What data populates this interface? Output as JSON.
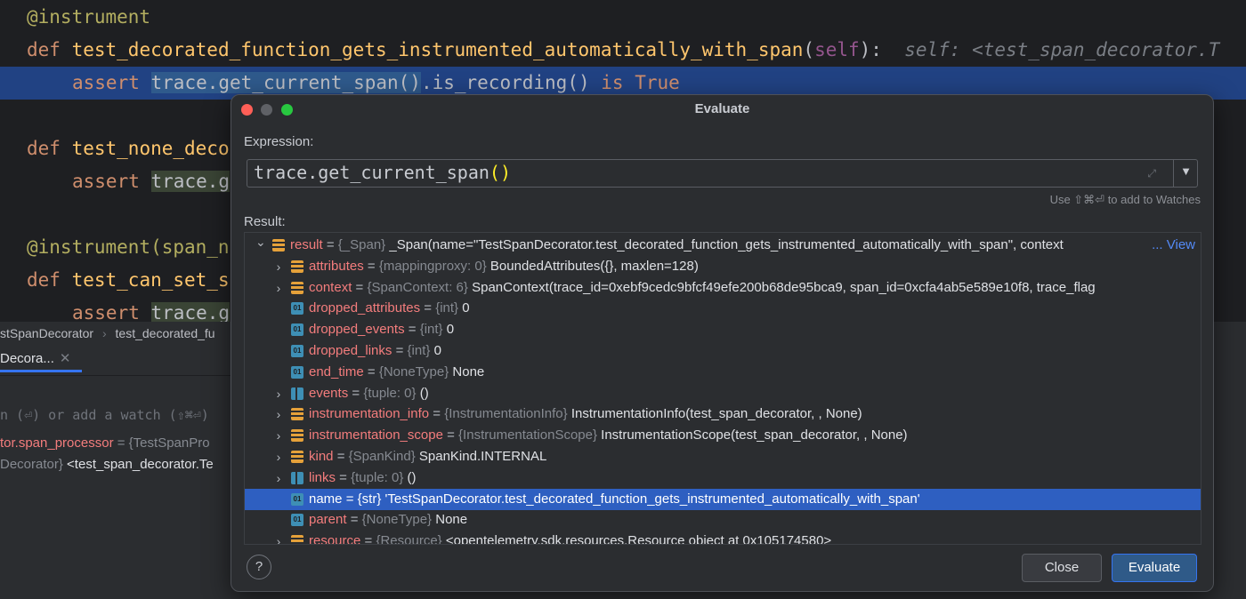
{
  "editor": {
    "line1": {
      "decorator": "@instrument"
    },
    "line2": {
      "kw": "def",
      "fn": "test_decorated_function_gets_instrumented_automatically_with_span",
      "open": "(",
      "self": "self",
      "close": "):",
      "hint": "self: <test_span_decorator.T"
    },
    "line3": {
      "kw": "assert",
      "call": "trace.get_current_span()",
      "rest": ".is_recording()",
      "is": "is",
      "val": "True"
    },
    "line5": {
      "kw": "def",
      "fn": "test_none_deco"
    },
    "line6": {
      "kw": "assert",
      "text": "trace.g"
    },
    "line8": {
      "decorator": "@instrument",
      "rest": "(span_n"
    },
    "line9": {
      "kw": "def",
      "fn": "test_can_set_s"
    },
    "line10": {
      "kw": "assert",
      "text": "trace.g"
    }
  },
  "lower": {
    "breadcrumb": [
      "stSpanDecorator",
      "test_decorated_fu"
    ],
    "breadcrumb_sep": "›",
    "tab_label": "Decora...",
    "tab_close": "✕",
    "watch_hint": "n (⏎) or add a watch (⇧⌘⏎)",
    "var1_name": "tor.span_processor",
    "var1_rest": "= {TestSpanPro",
    "var2_type": "Decorator}",
    "var2_val": "<test_span_decorator.Te"
  },
  "dialog": {
    "title": "Evaluate",
    "expression_label": "Expression:",
    "expression_main": "trace.get_current_span",
    "expression_parens": "()",
    "watch_hint": "Use ⇧⌘⏎ to add to Watches",
    "result_label": "Result:",
    "view_link": "... View",
    "close_button": "Close",
    "evaluate_button": "Evaluate",
    "help": "?",
    "colors": {
      "close": "#ff5f57",
      "minimize": "#5f6166",
      "zoom": "#28c840",
      "selection": "#2e5fc1"
    },
    "tree": [
      {
        "name": "result",
        "type": "{_Span}",
        "value": "_Span(name=\"TestSpanDecorator.test_decorated_function_gets_instrumented_automatically_with_span\", context",
        "icon": "obj",
        "arrow": "down",
        "indent": 0
      },
      {
        "name": "attributes",
        "type": "{mappingproxy: 0}",
        "value": "BoundedAttributes({}, maxlen=128)",
        "icon": "obj",
        "arrow": "right",
        "indent": 1
      },
      {
        "name": "context",
        "type": "{SpanContext: 6}",
        "value": "SpanContext(trace_id=0xebf9cedc9bfcf49efe200b68de95bca9, span_id=0xcfa4ab5e589e10f8, trace_flag",
        "icon": "obj",
        "arrow": "right",
        "indent": 1
      },
      {
        "name": "dropped_attributes",
        "type": "{int}",
        "value": "0",
        "icon": "prim",
        "arrow": "",
        "indent": 1
      },
      {
        "name": "dropped_events",
        "type": "{int}",
        "value": "0",
        "icon": "prim",
        "arrow": "",
        "indent": 1
      },
      {
        "name": "dropped_links",
        "type": "{int}",
        "value": "0",
        "icon": "prim",
        "arrow": "",
        "indent": 1
      },
      {
        "name": "end_time",
        "type": "{NoneType}",
        "value": "None",
        "icon": "prim",
        "arrow": "",
        "indent": 1
      },
      {
        "name": "events",
        "type": "{tuple: 0}",
        "value": "()",
        "icon": "coll",
        "arrow": "right",
        "indent": 1
      },
      {
        "name": "instrumentation_info",
        "type": "{InstrumentationInfo}",
        "value": "InstrumentationInfo(test_span_decorator, , None)",
        "icon": "obj",
        "arrow": "right",
        "indent": 1
      },
      {
        "name": "instrumentation_scope",
        "type": "{InstrumentationScope}",
        "value": "InstrumentationScope(test_span_decorator, , None)",
        "icon": "obj",
        "arrow": "right",
        "indent": 1
      },
      {
        "name": "kind",
        "type": "{SpanKind}",
        "value": "SpanKind.INTERNAL",
        "icon": "obj",
        "arrow": "right",
        "indent": 1
      },
      {
        "name": "links",
        "type": "{tuple: 0}",
        "value": "()",
        "icon": "coll",
        "arrow": "right",
        "indent": 1
      },
      {
        "name": "name",
        "type": "{str}",
        "value": "'TestSpanDecorator.test_decorated_function_gets_instrumented_automatically_with_span'",
        "icon": "prim",
        "arrow": "",
        "indent": 1,
        "selected": true
      },
      {
        "name": "parent",
        "type": "{NoneType}",
        "value": "None",
        "icon": "prim",
        "arrow": "",
        "indent": 1
      },
      {
        "name": "resource",
        "type": "{Resource}",
        "value": "<opentelemetry.sdk.resources.Resource object at 0x105174580>",
        "icon": "obj",
        "arrow": "right",
        "indent": 1
      }
    ]
  }
}
